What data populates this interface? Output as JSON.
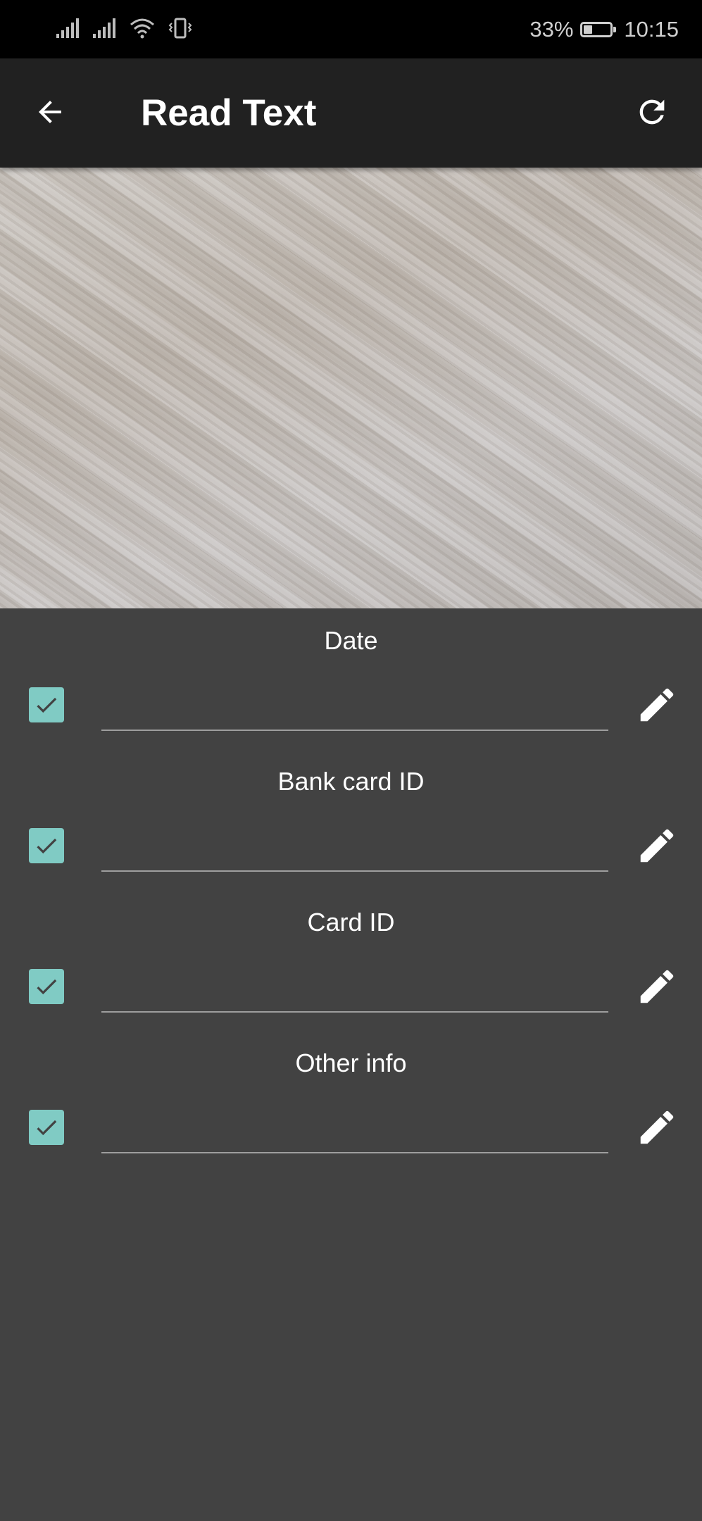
{
  "status_bar": {
    "battery_percent": "33%",
    "battery_level": 0.33,
    "time": "10:15",
    "icons": [
      "signal-icon",
      "signal-icon",
      "wifi-icon",
      "vibrate-icon",
      "battery-icon"
    ]
  },
  "app_bar": {
    "title": "Read Text",
    "back_icon": "arrow-left-icon",
    "refresh_icon": "refresh-icon"
  },
  "fields": [
    {
      "label": "Date",
      "value": "",
      "checked": true
    },
    {
      "label": "Bank card ID",
      "value": "",
      "checked": true
    },
    {
      "label": "Card ID",
      "value": "",
      "checked": true
    },
    {
      "label": "Other info",
      "value": "",
      "checked": true
    }
  ],
  "colors": {
    "checkbox": "#80cbc4",
    "background": "#424242",
    "app_bar": "#212121",
    "status_bar": "#000000"
  }
}
